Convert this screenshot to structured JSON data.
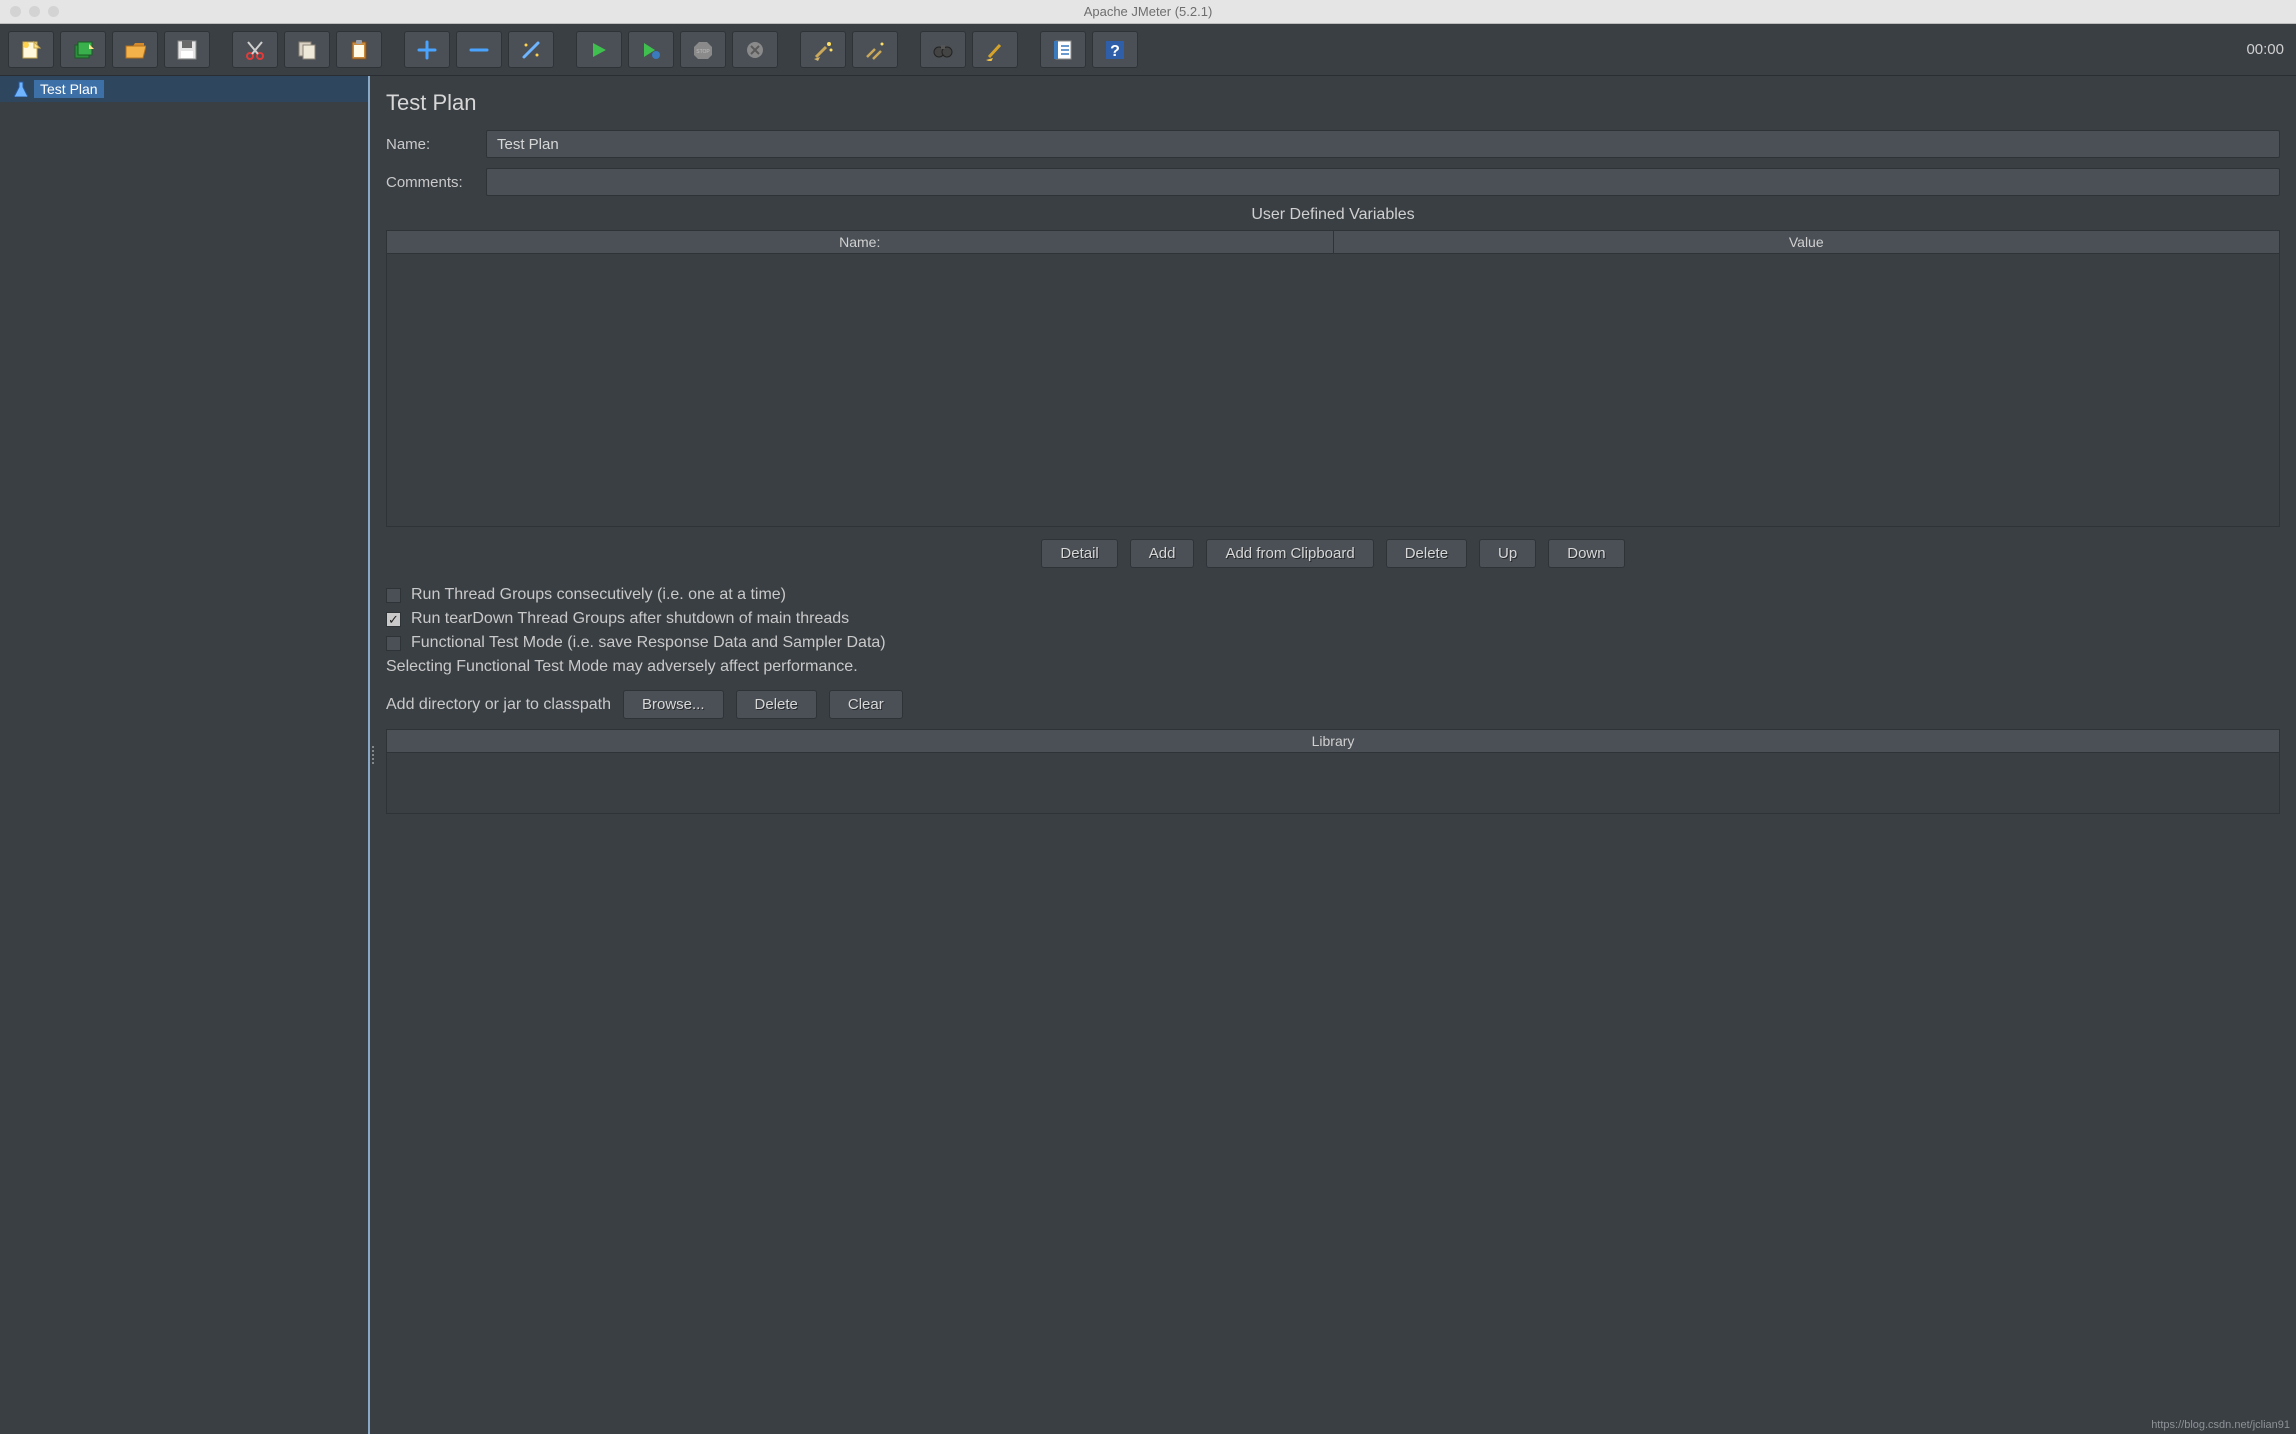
{
  "titlebar": {
    "title": "Apache JMeter (5.2.1)"
  },
  "toolbar": {
    "time": "00:00"
  },
  "tree": {
    "root_label": "Test Plan"
  },
  "panel": {
    "heading": "Test Plan",
    "name_label": "Name:",
    "name_value": "Test Plan",
    "comments_label": "Comments:",
    "comments_value": "",
    "udv_title": "User Defined Variables",
    "udv_cols": {
      "name": "Name:",
      "value": "Value"
    },
    "buttons": {
      "detail": "Detail",
      "add": "Add",
      "add_clip": "Add from Clipboard",
      "delete": "Delete",
      "up": "Up",
      "down": "Down"
    },
    "checks": {
      "consecutive": "Run Thread Groups consecutively (i.e. one at a time)",
      "teardown": "Run tearDown Thread Groups after shutdown of main threads",
      "functional": "Functional Test Mode (i.e. save Response Data and Sampler Data)"
    },
    "check_states": {
      "consecutive": false,
      "teardown": true,
      "functional": false
    },
    "functional_note": "Selecting Functional Test Mode may adversely affect performance.",
    "classpath_label": "Add directory or jar to classpath",
    "classpath_buttons": {
      "browse": "Browse...",
      "delete": "Delete",
      "clear": "Clear"
    },
    "library_col": "Library"
  },
  "watermark": "https://blog.csdn.net/jclian91"
}
